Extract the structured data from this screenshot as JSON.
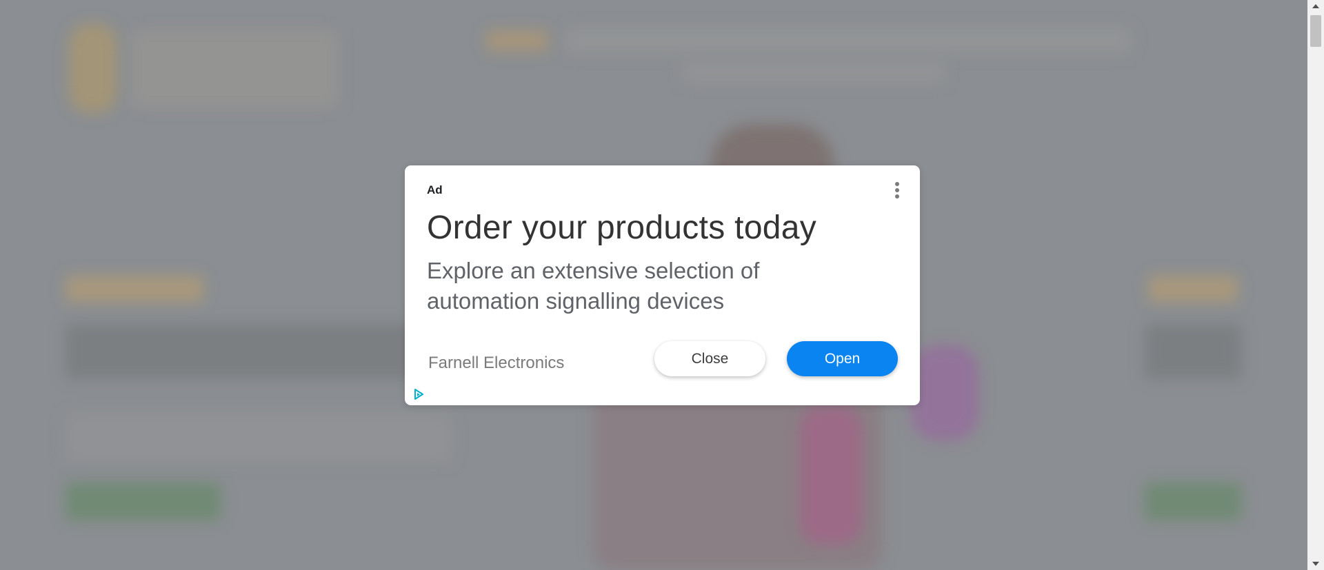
{
  "ad": {
    "label": "Ad",
    "title": "Order your products today",
    "description": "Explore an extensive selection of automation signalling devices",
    "advertiser": "Farnell Electronics",
    "close_label": "Close",
    "open_label": "Open",
    "accent_color": "#0a84f0"
  },
  "icons": {
    "menu": "more-vert-icon",
    "adchoices": "adchoices-icon",
    "scroll_up": "scroll-up-arrow-icon",
    "scroll_down": "scroll-down-arrow-icon"
  }
}
